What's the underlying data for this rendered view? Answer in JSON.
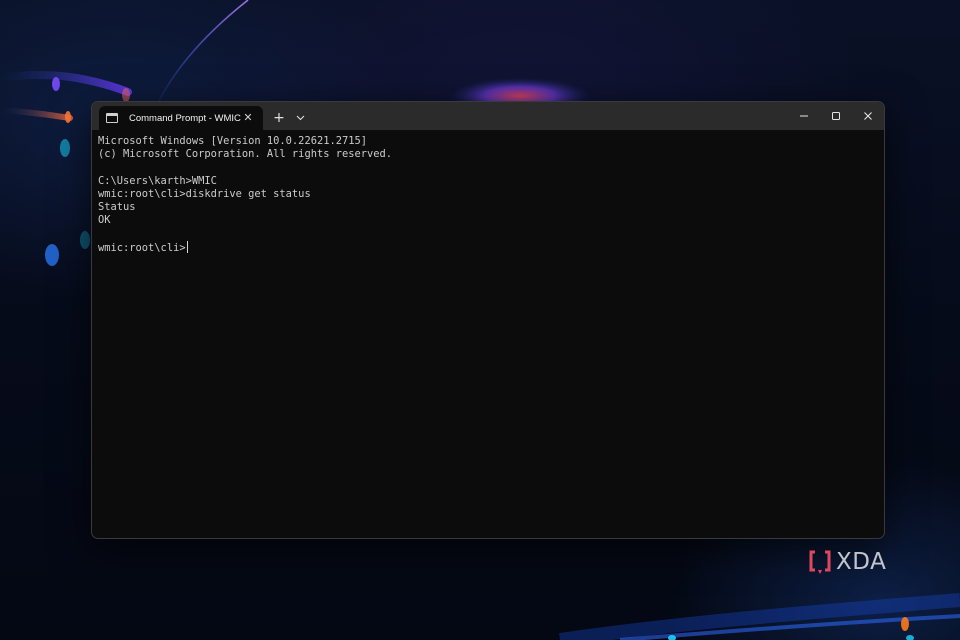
{
  "window": {
    "tab_title": "Command Prompt - WMIC",
    "tab_close_glyph": "✕",
    "new_tab_glyph": "+",
    "icons": {
      "tab": "terminal-icon",
      "dropdown": "chevron-down-icon",
      "minimize": "minimize-icon",
      "maximize": "maximize-icon",
      "close": "close-icon"
    }
  },
  "console": {
    "lines": [
      "Microsoft Windows [Version 10.0.22621.2715]",
      "(c) Microsoft Corporation. All rights reserved.",
      "",
      "C:\\Users\\karth>WMIC",
      "wmic:root\\cli>diskdrive get status",
      "Status",
      "OK",
      "",
      "wmic:root\\cli>"
    ]
  },
  "watermark": {
    "text": "XDA",
    "icon": "xda-logo-icon"
  },
  "colors": {
    "console_bg": "#0c0c0c",
    "console_text": "#cccccc",
    "titlebar_bg": "#2b2b2b",
    "logo_accent": "#e0475b"
  }
}
